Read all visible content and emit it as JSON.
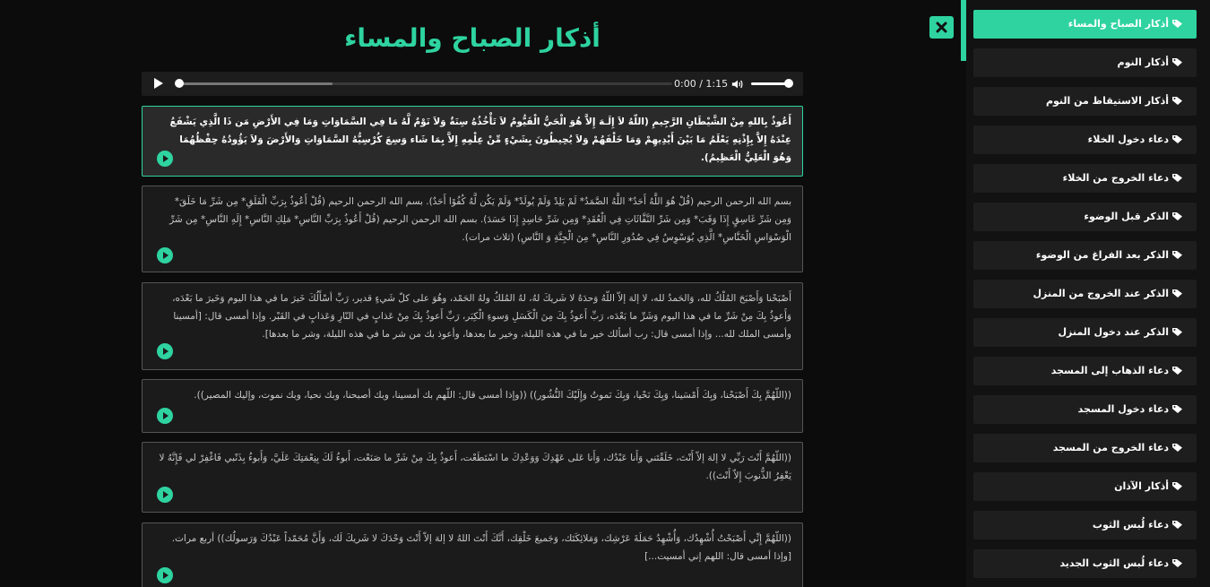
{
  "title": "أذكار الصباح والمساء",
  "colors": {
    "accent": "#2ed3a0",
    "background": "#0c0c0c",
    "card": "#1b1b1b",
    "sidebar_item": "#1e1e1e"
  },
  "player": {
    "time": "0:00 / 1:15",
    "progress": 0.0,
    "volume": 1.0,
    "icons": {
      "play": "play-icon",
      "volume": "volume-icon"
    }
  },
  "close_icon": "close-icon",
  "sidebar": {
    "icon": "tag-icon",
    "items": [
      {
        "label": "أذكار الصباح والمساء",
        "active": true
      },
      {
        "label": "أذكار النوم"
      },
      {
        "label": "أذكار الاستيقاظ من النوم"
      },
      {
        "label": "دعاء دخول الخلاء"
      },
      {
        "label": "دعاء الخروج من الخلاء"
      },
      {
        "label": "الذكر قبل الوضوء"
      },
      {
        "label": "الذكر بعد الفراغ من الوضوء"
      },
      {
        "label": "الذكر عند الخروج من المنزل"
      },
      {
        "label": "الذكر عند دخول المنزل"
      },
      {
        "label": "دعاء الذهاب إلى المسجد"
      },
      {
        "label": "دعاء دخول المسجد"
      },
      {
        "label": "دعاء الخروج من المسجد"
      },
      {
        "label": "أذكار الآذان"
      },
      {
        "label": "دعاء لُبس الثوب"
      },
      {
        "label": "دعاء لُبس الثوب الجديد"
      }
    ]
  },
  "cards": [
    {
      "active": true,
      "text": "أَعُوذُ بِاللهِ مِنْ الشَّيْطَانِ الرَّجِيمِ (اللّهُ لاَ إِلَـهَ إِلاَّ هُوَ الْحَيُّ الْقَيُّومُ لاَ تَأْخُذُهُ سِنَةٌ وَلاَ نَوْمٌ لَّهُ مَا فِي السَّمَاوَاتِ وَمَا فِي الأَرْضِ مَن ذَا الَّذِي يَشْفَعُ عِنْدَهُ إِلاَّ بِإِذْنِهِ يَعْلَمُ مَا بَيْنَ أَيْدِيهِمْ وَمَا خَلْفَهُمْ وَلاَ يُحِيطُونَ بِشَيْءٍ مِّنْ عِلْمِهِ إِلاَّ بِمَا شَاء وَسِعَ كُرْسِيُّهُ السَّمَاوَاتِ وَالأَرْضَ وَلاَ يَؤُودُهُ حِفْظُهُمَا وَهُوَ الْعَلِيُّ الْعَظِيمُ)."
    },
    {
      "text": "بسم الله الرحمن الرحيم (قُلْ هُوَ اللَّهُ أَحَدٌ* اللَّهُ الصَّمَدُ* لَمْ يَلِدْ وَلَمْ يُولَدْ* وَلَمْ يَكُن لَّهُ كُفُوًا أَحَدٌ). بسم الله الرحمن الرحيم (قُلْ أَعُوذُ بِرَبِّ الْفَلَقِ* مِن شَرِّ مَا خَلَقَ* وَمِن شَرِّ غَاسِقٍ إِذَا وَقَبَ* وَمِن شَرِّ النَّفَّاثَاتِ فِي الْعُقَدِ* وَمِن شَرِّ حَاسِدٍ إِذَا حَسَدَ). بسم الله الرحمن الرحيم (قُلْ أَعُوذُ بِرَبِّ النَّاسِ* مَلِكِ النَّاسِ* إِلَهِ النَّاسِ* مِن شَرِّ الْوَسْوَاسِ الْخَنَّاسِ* الَّذِي يُوَسْوِسُ فِي صُدُورِ النَّاسِ* مِنَ الْجِنَّةِ وَ النَّاسِ) (ثلاث مرات)."
    },
    {
      "text": "أَصْبَحْنا وَأَصْبَحَ المُلْكُ لله، وَالحَمدُ لله، لا إلهَ إلاّ اللّهُ وَحدَهُ لا شَريكَ لهُ، لهُ المُلكُ ولهُ الحَمْد، وهُوَ على كلّ شَيءٍ قدير، رَبِّ أسْأَلُكَ خَيرَ ما في هذا اليوم وَخَيرَ ما بَعْدَه، وَأَعوذُ بِكَ مِنْ شَرِّ ما في هذا اليوم وَشَرِّ ما بَعْدَه، رَبِّ أَعوذُ بِكَ مِنَ الْكَسَلِ وَسوءِ الْكِبَر، رَبِّ أَعوذُ بِكَ مِنْ عَذابٍ في النّارِ وَعَذابٍ في القَبْر. وإذا أمسى قال: [أمسينا وأمسى الملك لله... وإذا أمسى قال: رب أسألك خير ما في هذه الليلة، وخير ما بعدها، وأعوذ بك من شر ما في هذه الليلة، وشر ما بعدها]."
    },
    {
      "text": "((اللّهُمَّ بِكَ أَصْبَحْنا، وَبِكَ أَمْسَينا، وَبِكَ نَحْيا، وَبِكَ نَموتُ وَإِلَيْكَ النُّشُور)) ((وإذا أمسى قال: اللّهم بك أمسينا، وبك أصبحنا، وبك نحيا، وبك نموت، وإليك المصير))."
    },
    {
      "text": "((اللّهُمَّ أَنْتَ رَبِّي لا إلهَ إلاّ أَنْتَ، خَلَقْتَني وَأَنا عَبْدُك، وَأَنا عَلى عَهْدِكَ وَوَعْدِكَ ما اسْتَطَعْت، أَعوذُ بِكَ مِنْ شَرِّ ما صَنَعْت، أَبوءُ لَكَ بِنِعْمَتِكَ عَلَيَّ، وَأَبوءُ بِذَنْبي فَاغْفِرْ لي فَإِنَّهُ لا يَغْفِرُ الذُّنوبَ إِلاّ أَنْتَ))."
    },
    {
      "text": "((اللّهُمَّ إِنِّي أَصْبَحْتُ أُشْهِدُك، وَأُشْهِدُ حَمَلَةَ عَرْشِك، وَمَلائِكَتَك، وَجَميعَ خَلْقِك، أَنَّكَ أَنْتَ اللهُ لا إلهَ إلاّ أَنْتَ وَحْدَكَ لا شَريكَ لَك، وَأَنَّ مُحَمّداً عَبْدُكَ وَرَسولُك)) أربع مرات. [وإذا أمسى قال: اللهم إني أمسيت...]"
    }
  ]
}
